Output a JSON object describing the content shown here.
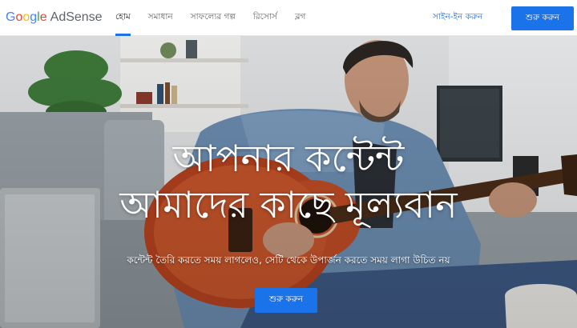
{
  "header": {
    "logo": {
      "google_letters": [
        "G",
        "o",
        "o",
        "g",
        "l",
        "e"
      ],
      "google_colors": [
        "#4285F4",
        "#EA4335",
        "#FBBC05",
        "#4285F4",
        "#34A853",
        "#EA4335"
      ],
      "product": "AdSense"
    },
    "nav": [
      {
        "label": "হোম",
        "active": true
      },
      {
        "label": "সমাধান",
        "active": false
      },
      {
        "label": "সাফল্যের গল্প",
        "active": false
      },
      {
        "label": "রিসোর্স",
        "active": false
      },
      {
        "label": "ব্লগ",
        "active": false
      }
    ],
    "signin_label": "সাইন-ইন করুন",
    "start_label": "শুরু করুন"
  },
  "hero": {
    "headline_line1": "আপনার কন্টেন্ট",
    "headline_line2": "আমাদের কাছে মূল্যবান",
    "subtext": "কন্টেন্ট তৈরি করতে সময় লাগলেও, সেটি থেকে উপার্জন করতে সময় লাগা উচিত নয়",
    "cta_label": "শুরু করুন"
  },
  "colors": {
    "accent": "#1a73e8",
    "nav_text": "#5f6368",
    "guitar_body": "#b8431f"
  }
}
